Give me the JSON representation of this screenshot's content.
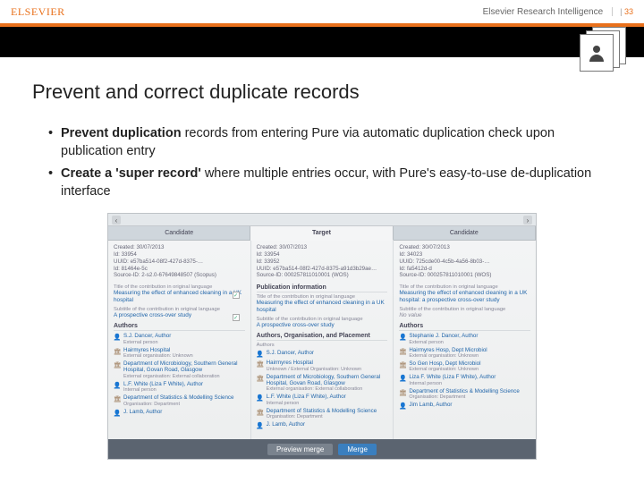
{
  "header": {
    "logo": "ELSEVIER",
    "right_label": "Elsevier Research Intelligence",
    "page_number": "33"
  },
  "title": "Prevent and correct duplicate records",
  "bullets": [
    {
      "bold": "Prevent duplication",
      "rest": " records from entering Pure via automatic duplication check upon publication entry"
    },
    {
      "bold": "Create a 'super record'",
      "rest": " where multiple entries occur, with Pure's easy-to-use de-duplication interface"
    }
  ],
  "dedup": {
    "tabs": {
      "left": "Candidate",
      "center": "Target",
      "right": "Candidate"
    },
    "col_left": {
      "meta": {
        "created": "Created: 30/07/2013",
        "id": "Id: 33954",
        "uuid": "UUID: e57ba514-08f2-427d-8375-…",
        "src1": "Id: 81464e-5c",
        "src2": "Source-ID: 2-s2.0-67649848507 (Scopus)"
      },
      "pub_title_lbl": "Title of the contribution in original language",
      "pub_title": "Measuring the effect of enhanced cleaning in a UK hospital",
      "sub_title_lbl": "Subtitle of the contribution in original language",
      "sub_title": "A prospective cross-over study",
      "authors_hd": "Authors",
      "items": [
        {
          "t": "person",
          "name": "S.J. Dancer, Author",
          "sub": "External person"
        },
        {
          "t": "org",
          "name": "Hairmyres Hospital",
          "sub": "External organisation: Unknown"
        },
        {
          "t": "org",
          "name": "Department of Microbiology, Southern General Hospital, Govan Road, Glasgow",
          "sub": "External organisation: External collaboration"
        },
        {
          "t": "person",
          "name": "L.F. White (Liza F White), Author",
          "sub": "Internal person"
        },
        {
          "t": "org",
          "name": "Department of Statistics & Modelling Science",
          "sub": "Organisation: Department"
        },
        {
          "t": "person",
          "name": "J. Lamb, Author",
          "sub": ""
        }
      ]
    },
    "col_center": {
      "meta": {
        "created": "Created: 30/07/2013",
        "id": "Id: 33954",
        "uuid2": "Id: 33952",
        "uuid": "UUID: e57ba514-08f2-427d-8375-a91d3b29ae…",
        "src": "Source-ID: 000257811010001 (WOS)"
      },
      "pub_hd": "Publication information",
      "pub_title_lbl": "Title of the contribution in original language",
      "pub_title": "Measuring the effect of enhanced cleaning in a UK hospital",
      "sub_title_lbl": "Subtitle of the contribution in original language",
      "sub_title": "A prospective cross-over study",
      "aop_hd": "Authors, Organisation, and Placement",
      "authors_lbl": "Authors",
      "items": [
        {
          "t": "person",
          "name": "S.J. Dancer, Author"
        },
        {
          "t": "org",
          "name": "Hairmyres Hospital",
          "sub": "Unknown / External Organisation: Unknown"
        },
        {
          "t": "org",
          "name": "Department of Microbiology, Southern General Hospital, Govan Road, Glasgow",
          "sub": "External organisation: External collaboration"
        },
        {
          "t": "person",
          "name": "L.F. White (Liza F White), Author",
          "sub": "Internal person"
        },
        {
          "t": "org",
          "name": "Department of Statistics & Modelling Science",
          "sub": "Organisation: Department"
        },
        {
          "t": "person",
          "name": "J. Lamb, Author"
        }
      ]
    },
    "col_right": {
      "meta": {
        "created": "Created: 30/07/2013",
        "id": "Id: 34023",
        "uuid": "UUID: 725cde00-4c5b-4a56-8b03-…",
        "src1": "Id: fa5412d-d",
        "src2": "Source-ID: 000257811010001 (WOS)"
      },
      "pub_title_lbl": "Title of the contribution in original language",
      "pub_title": "Measuring the effect of enhanced cleaning in a UK hospital: a prospective cross-over study",
      "sub_title_lbl": "Subtitle of the contribution in original language",
      "sub_title": "No value",
      "authors_hd": "Authors",
      "items": [
        {
          "t": "person",
          "name": "Stephanie J. Dancer, Author",
          "sub": "External person"
        },
        {
          "t": "org",
          "name": "Hairmyres Hosp, Dept Microbiol",
          "sub": "External organisation: Unknown"
        },
        {
          "t": "org",
          "name": "So Gen Hosp, Dept Microbiol",
          "sub": "External organisation: Unknown"
        },
        {
          "t": "person",
          "name": "Liza F. White (Liza F White), Author",
          "sub": "Internal person"
        },
        {
          "t": "org",
          "name": "Department of Statistics & Modelling Science",
          "sub": "Organisation: Department"
        },
        {
          "t": "person",
          "name": "Jim Lamb, Author",
          "sub": ""
        }
      ]
    },
    "buttons": {
      "preview": "Preview merge",
      "merge": "Merge"
    }
  }
}
